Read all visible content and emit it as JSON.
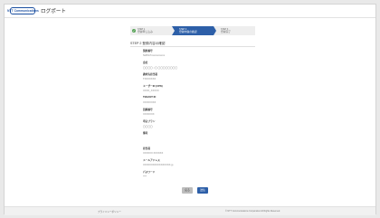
{
  "header": {
    "logo_text": "NTT Communications",
    "title": "ログポート"
  },
  "steps": [
    {
      "num": "STEP 1",
      "label": "登録申し込み"
    },
    {
      "num": "STEP 2",
      "label": "登録内容の確認"
    },
    {
      "num": "STEP 3",
      "label": "登録完了"
    }
  ],
  "section_title": "STEP 2 登録内容の確認",
  "fields": [
    {
      "label": "契約番号",
      "value": "NWNx7xxxxxxxxxxx"
    },
    {
      "label": "会社",
      "value": "〇〇〇〇 ○〇 〇〇〇〇〇〇〇〇"
    },
    {
      "label": "請求先担当者",
      "value": "TXXXXXXX"
    },
    {
      "label": "ユーザーID (UPN)",
      "value": "XXXX_XXXXX"
    },
    {
      "label": "TENANT ID",
      "value": "XXXXXXXX"
    },
    {
      "label": "回線番号",
      "value": "XXXXXXX"
    },
    {
      "label": "申込プラン",
      "value": "〇〇〇〇"
    },
    {
      "label": "備考",
      "value": ""
    },
    {
      "label": "担当者",
      "value": "XXXXXX XXXXXX"
    },
    {
      "label": "メールアドレス",
      "value": "XXXXXXXXXXXXXXXXX.jp"
    },
    {
      "label": "パスワード",
      "value": "****"
    }
  ],
  "buttons": {
    "back": "戻る",
    "submit": "送信"
  },
  "footer": {
    "privacy": "プライバシーポリシー",
    "copyright": "© NTT Communications Corporation All Rights Reserved."
  },
  "colors": {
    "accent": "#2d5fa8",
    "step_done": "#5aa55a",
    "brand_orange": "#e08a12"
  }
}
